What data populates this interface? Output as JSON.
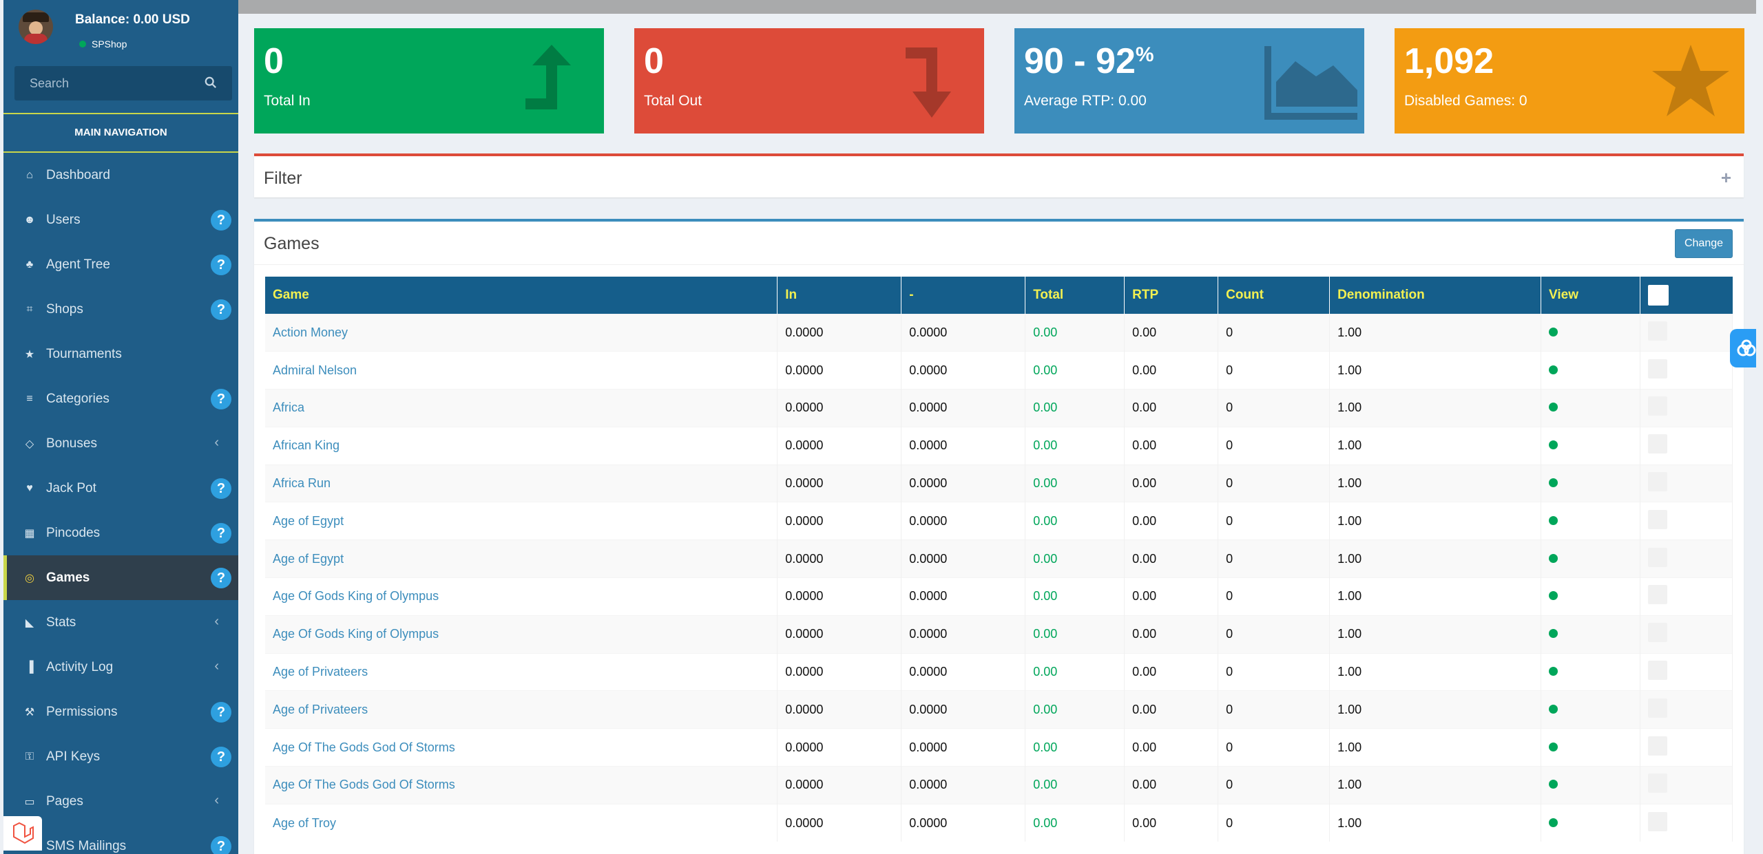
{
  "user": {
    "balance": "Balance: 0.00 USD",
    "shop": "SPShop"
  },
  "search": {
    "placeholder": "Search"
  },
  "nav": {
    "header": "MAIN NAVIGATION",
    "items": [
      {
        "label": "Dashboard",
        "icon": "dashboard-icon",
        "badge": "",
        "chevron": false
      },
      {
        "label": "Users",
        "icon": "user-icon",
        "badge": "?",
        "chevron": false
      },
      {
        "label": "Agent Tree",
        "icon": "tree-icon",
        "badge": "?",
        "chevron": false
      },
      {
        "label": "Shops",
        "icon": "bank-icon",
        "badge": "?",
        "chevron": false
      },
      {
        "label": "Tournaments",
        "icon": "trophy-icon",
        "badge": "",
        "chevron": false
      },
      {
        "label": "Categories",
        "icon": "list-icon",
        "badge": "?",
        "chevron": false
      },
      {
        "label": "Bonuses",
        "icon": "diamond-icon",
        "badge": "",
        "chevron": true
      },
      {
        "label": "Jack Pot",
        "icon": "heartbeat-icon",
        "badge": "?",
        "chevron": false
      },
      {
        "label": "Pincodes",
        "icon": "grid-icon",
        "badge": "?",
        "chevron": false
      },
      {
        "label": "Games",
        "icon": "gamepad-icon",
        "badge": "?",
        "chevron": false
      },
      {
        "label": "Stats",
        "icon": "area-chart-icon",
        "badge": "",
        "chevron": true
      },
      {
        "label": "Activity Log",
        "icon": "bar-chart-icon",
        "badge": "",
        "chevron": true
      },
      {
        "label": "Permissions",
        "icon": "gavel-icon",
        "badge": "?",
        "chevron": false
      },
      {
        "label": "API Keys",
        "icon": "key-icon",
        "badge": "?",
        "chevron": false
      },
      {
        "label": "Pages",
        "icon": "comment-icon",
        "badge": "",
        "chevron": true
      },
      {
        "label": "SMS Mailings",
        "icon": "sms-icon",
        "badge": "?",
        "chevron": false
      }
    ]
  },
  "stats": {
    "total_in": {
      "value": "0",
      "label": "Total In"
    },
    "total_out": {
      "value": "0",
      "label": "Total Out"
    },
    "rtp": {
      "value": "90 - 92",
      "unit": "%",
      "label": "Average RTP: 0.00"
    },
    "disabled": {
      "value": "1,092",
      "label": "Disabled Games: 0"
    }
  },
  "filter": {
    "title": "Filter",
    "toggle": "+"
  },
  "games": {
    "title": "Games",
    "change_label": "Change",
    "columns": [
      "Game",
      "In",
      "-",
      "Total",
      "RTP",
      "Count",
      "Denomination",
      "View"
    ],
    "rows": [
      {
        "game": "Action Money",
        "in": "0.0000",
        "out": "0.0000",
        "total": "0.00",
        "rtp": "0.00",
        "count": "0",
        "denomination": "1.00"
      },
      {
        "game": "Admiral Nelson",
        "in": "0.0000",
        "out": "0.0000",
        "total": "0.00",
        "rtp": "0.00",
        "count": "0",
        "denomination": "1.00"
      },
      {
        "game": "Africa",
        "in": "0.0000",
        "out": "0.0000",
        "total": "0.00",
        "rtp": "0.00",
        "count": "0",
        "denomination": "1.00"
      },
      {
        "game": "African King",
        "in": "0.0000",
        "out": "0.0000",
        "total": "0.00",
        "rtp": "0.00",
        "count": "0",
        "denomination": "1.00"
      },
      {
        "game": "Africa Run",
        "in": "0.0000",
        "out": "0.0000",
        "total": "0.00",
        "rtp": "0.00",
        "count": "0",
        "denomination": "1.00"
      },
      {
        "game": "Age of Egypt",
        "in": "0.0000",
        "out": "0.0000",
        "total": "0.00",
        "rtp": "0.00",
        "count": "0",
        "denomination": "1.00"
      },
      {
        "game": "Age of Egypt",
        "in": "0.0000",
        "out": "0.0000",
        "total": "0.00",
        "rtp": "0.00",
        "count": "0",
        "denomination": "1.00"
      },
      {
        "game": "Age Of Gods King of Olympus",
        "in": "0.0000",
        "out": "0.0000",
        "total": "0.00",
        "rtp": "0.00",
        "count": "0",
        "denomination": "1.00"
      },
      {
        "game": "Age Of Gods King of Olympus",
        "in": "0.0000",
        "out": "0.0000",
        "total": "0.00",
        "rtp": "0.00",
        "count": "0",
        "denomination": "1.00"
      },
      {
        "game": "Age of Privateers",
        "in": "0.0000",
        "out": "0.0000",
        "total": "0.00",
        "rtp": "0.00",
        "count": "0",
        "denomination": "1.00"
      },
      {
        "game": "Age of Privateers",
        "in": "0.0000",
        "out": "0.0000",
        "total": "0.00",
        "rtp": "0.00",
        "count": "0",
        "denomination": "1.00"
      },
      {
        "game": "Age Of The Gods God Of Storms",
        "in": "0.0000",
        "out": "0.0000",
        "total": "0.00",
        "rtp": "0.00",
        "count": "0",
        "denomination": "1.00"
      },
      {
        "game": "Age Of The Gods God Of Storms",
        "in": "0.0000",
        "out": "0.0000",
        "total": "0.00",
        "rtp": "0.00",
        "count": "0",
        "denomination": "1.00"
      },
      {
        "game": "Age of Troy",
        "in": "0.0000",
        "out": "0.0000",
        "total": "0.00",
        "rtp": "0.00",
        "count": "0",
        "denomination": "1.00"
      }
    ]
  },
  "colors": {
    "sidebar": "#1f5d88",
    "green": "#00a65a",
    "red": "#dd4b39",
    "blue": "#3c8dbc",
    "orange": "#f39c12",
    "header_text": "#f2f051"
  }
}
